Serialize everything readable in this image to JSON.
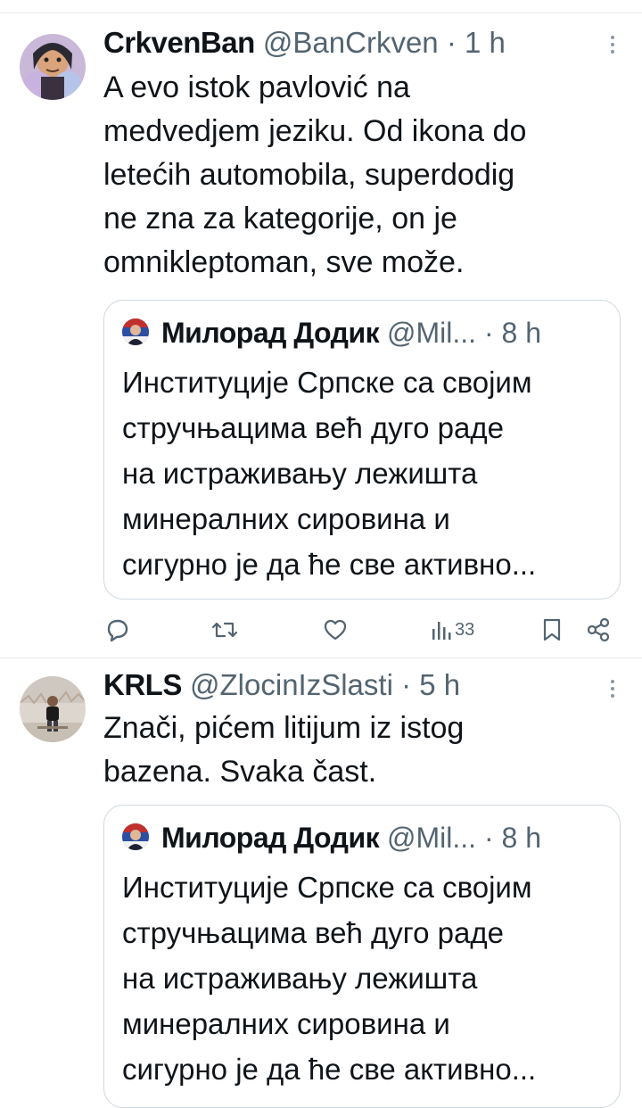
{
  "tweets": [
    {
      "author_name": "CrkvenBan",
      "author_handle": "@BanCrkven",
      "time": "· 1 h",
      "text": "A evo istok pavlović na\nmedvedjem jeziku. Od ikona do\nletećih automobila, superdodig\nne zna za kategorije, on je\nomnikleptoman, sve može.",
      "quote": {
        "author_name": "Милорад Додик",
        "author_handle": "@Mil...",
        "time": "· 8 h",
        "text": "Институције Српске са својим\nстручњацима већ дуго раде\nна истраживању лежишта\nминералних сировина и\nсигурно је да ће све активно..."
      },
      "actions": {
        "reply_count": "",
        "retweet_count": "",
        "like_count": "",
        "views_count": "33"
      }
    },
    {
      "author_name": "KRLS",
      "author_handle": "@ZlocinIzSlasti",
      "time": "· 5 h",
      "text": "Znači, pićem litijum iz istog\nbazena. Svaka čast.",
      "quote": {
        "author_name": "Милорад Додик",
        "author_handle": "@Mil...",
        "time": "· 8 h",
        "text": "Институције Српске са својим\nстручњацима већ дуго раде\nна истраживању лежишта\nминералних сировина и\nсигурно је да ће све активно..."
      }
    }
  ],
  "colors": {
    "text": "#0f1419",
    "secondary": "#536471",
    "border": "#cfd9de",
    "divider": "#e6e9ec"
  },
  "icons": [
    "reply-icon",
    "retweet-icon",
    "like-icon",
    "views-icon",
    "bookmark-icon",
    "share-icon",
    "more-icon"
  ]
}
